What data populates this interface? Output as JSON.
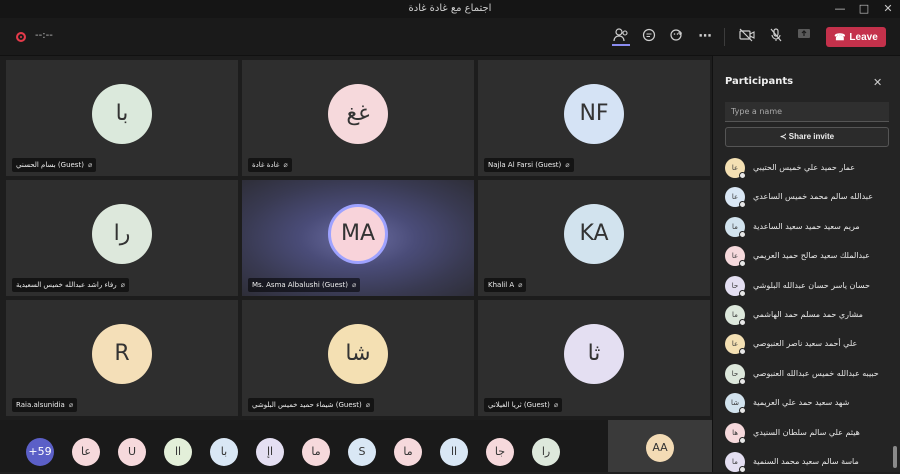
{
  "window": {
    "title": "اجتماع مع غادة غادة"
  },
  "toolbar": {
    "timer": "--:--",
    "leave_label": "Leave"
  },
  "tiles": [
    {
      "initials": "با",
      "name": "بسام الحسني (Guest)",
      "color": "#dbe9dc"
    },
    {
      "initials": "غغ",
      "name": "غادة غادة",
      "color": "#f6d9dc"
    },
    {
      "initials": "NF",
      "name": "Najla Al Farsi (Guest)",
      "color": "#d5e3f5"
    },
    {
      "initials": "را",
      "name": "رفاء راشد عبدالله خميس السعيدية",
      "color": "#dde8dc"
    },
    {
      "initials": "MA",
      "name": "Ms. Asma Albalushi (Guest)",
      "color": "#f8d3da"
    },
    {
      "initials": "KA",
      "name": "Khalil A",
      "color": "#d2e3ee"
    },
    {
      "initials": "R",
      "name": "Raia.alsunidia",
      "color": "#f4dfb8"
    },
    {
      "initials": "شا",
      "name": "شيماء حميد خميس البلوشي (Guest)",
      "color": "#f4e0b3"
    },
    {
      "initials": "ثا",
      "name": "ثريا الغيلاني (Guest)",
      "color": "#e4dff2"
    }
  ],
  "strip": [
    {
      "initials": "+59",
      "color": "#5b5fc7"
    },
    {
      "initials": "عا",
      "color": "#f6d9dc"
    },
    {
      "initials": "U",
      "color": "#f6d9dc"
    },
    {
      "initials": "اا",
      "color": "#e3efd9"
    },
    {
      "initials": "با",
      "color": "#d9e7f5"
    },
    {
      "initials": "اإ",
      "color": "#e4dff2"
    },
    {
      "initials": "ما",
      "color": "#f6d9dc"
    },
    {
      "initials": "S",
      "color": "#d9e7f5"
    },
    {
      "initials": "ما",
      "color": "#f6d9dc"
    },
    {
      "initials": "اا",
      "color": "#d9e7f5"
    },
    {
      "initials": "جا",
      "color": "#f6d9dc"
    },
    {
      "initials": "را",
      "color": "#dde8dc"
    }
  ],
  "self_view": {
    "initials": "AA"
  },
  "panel": {
    "title": "Participants",
    "search_placeholder": "Type a name",
    "share_label": "Share invite",
    "participants": [
      {
        "initials": "عا",
        "name": "عمار حميد علي خميس الحتيبي",
        "color": "#f4e0b3"
      },
      {
        "initials": "عا",
        "name": "عبدالله سالم محمد خميس الساعدي",
        "color": "#d9e7f5"
      },
      {
        "initials": "ما",
        "name": "مريم سعيد حميد سعيد الساعدية",
        "color": "#d2e3ee"
      },
      {
        "initials": "عا",
        "name": "عبدالملك سعيد صالح حميد العريمي",
        "color": "#f6d9dc"
      },
      {
        "initials": "حا",
        "name": "حسان ياسر حسان عبدالله البلوشي",
        "color": "#e4dff2"
      },
      {
        "initials": "ما",
        "name": "مشاري حمد مسلم حمد الهاشمي",
        "color": "#dde8dc"
      },
      {
        "initials": "عا",
        "name": "علي أحمد سعيد ناصر العنبوصي",
        "color": "#f4e0b3"
      },
      {
        "initials": "حا",
        "name": "حبيبه عبدالله خميس عبدالله العنبوصي",
        "color": "#dde8dc"
      },
      {
        "initials": "شا",
        "name": "شهد سعيد حمد علي العريمية",
        "color": "#d2e3ee"
      },
      {
        "initials": "ها",
        "name": "هيثم علي سالم سلطان السنيدي",
        "color": "#f6d9dc"
      },
      {
        "initials": "ما",
        "name": "ماسة سالم سعيد محمد السنمية",
        "color": "#e4dff2"
      }
    ]
  }
}
